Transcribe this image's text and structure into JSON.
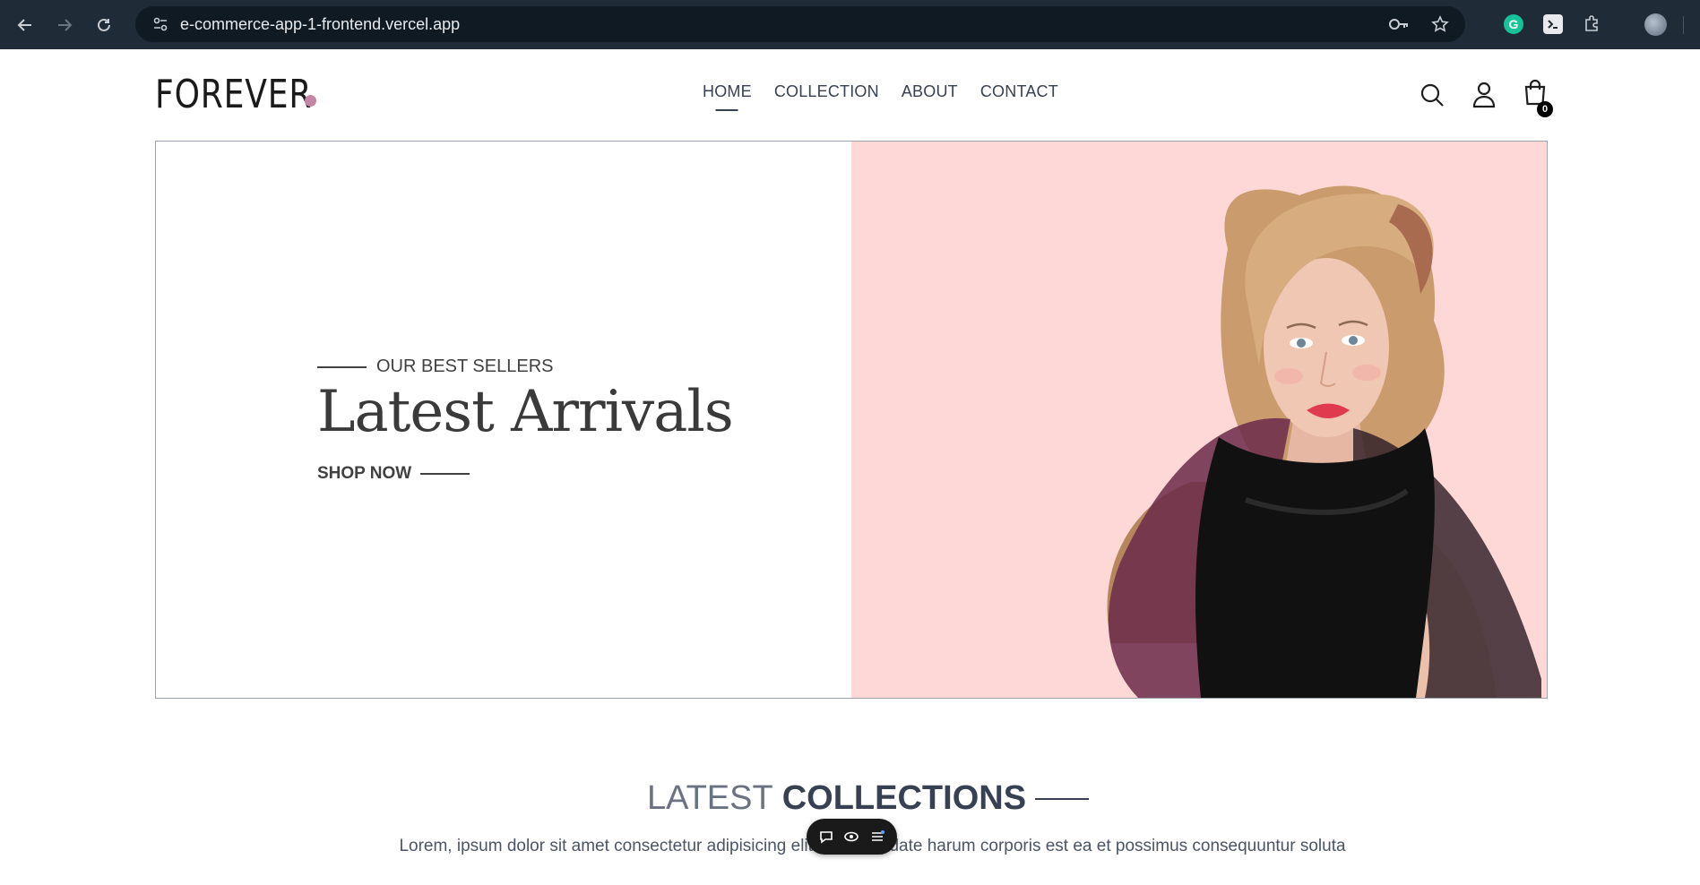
{
  "browser": {
    "url": "e-commerce-app-1-frontend.vercel.app"
  },
  "site": {
    "logo_text": "FOREVER",
    "nav": [
      {
        "label": "HOME",
        "active": true
      },
      {
        "label": "COLLECTION",
        "active": false
      },
      {
        "label": "ABOUT",
        "active": false
      },
      {
        "label": "CONTACT",
        "active": false
      }
    ],
    "cart_count": "0",
    "accent_color": "#c586a5"
  },
  "hero": {
    "eyebrow": "OUR BEST SELLERS",
    "headline": "Latest Arrivals",
    "cta": "SHOP NOW",
    "background_color": "#fed8d6"
  },
  "collections": {
    "title_light": "LATEST",
    "title_bold": "COLLECTIONS",
    "description": "Lorem, ipsum dolor sit amet consectetur adipisicing elit. Nobis update harum corporis est ea et possimus consequuntur soluta"
  }
}
